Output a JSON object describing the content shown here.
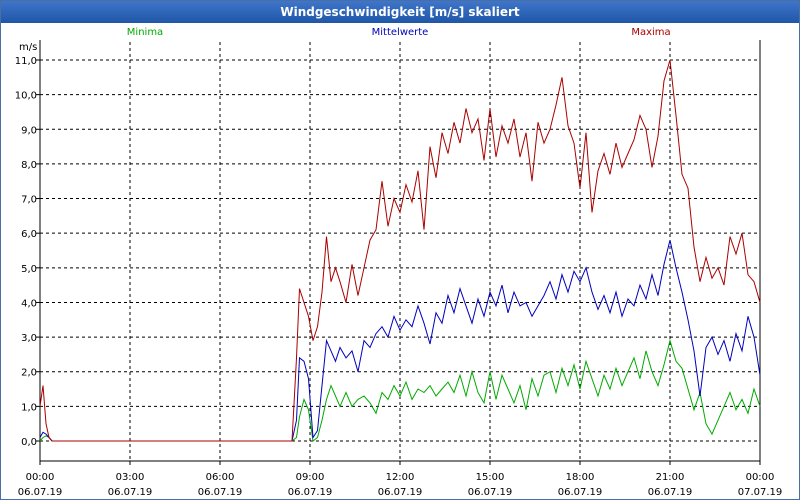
{
  "window": {
    "title": "Windgeschwindigkeit [m/s] skaliert"
  },
  "colors": {
    "min": "#00aa00",
    "mean": "#0000bb",
    "max": "#aa0000",
    "grid": "#000000"
  },
  "chart_data": {
    "type": "line",
    "title": "Windgeschwindigkeit [m/s] skaliert",
    "ylabel": "m/s",
    "ylim": [
      0,
      11
    ],
    "xlim": [
      "06.07.19 00:00",
      "07.07.19 00:00"
    ],
    "grid": true,
    "legend_position": "top",
    "yticks": [
      "0,0",
      "1,0",
      "2,0",
      "3,0",
      "4,0",
      "5,0",
      "6,0",
      "7,0",
      "8,0",
      "9,0",
      "10,0",
      "11,0"
    ],
    "xticks": [
      {
        "time": "00:00",
        "date": "06.07.19"
      },
      {
        "time": "03:00",
        "date": "06.07.19"
      },
      {
        "time": "06:00",
        "date": "06.07.19"
      },
      {
        "time": "09:00",
        "date": "06.07.19"
      },
      {
        "time": "12:00",
        "date": "06.07.19"
      },
      {
        "time": "15:00",
        "date": "06.07.19"
      },
      {
        "time": "18:00",
        "date": "06.07.19"
      },
      {
        "time": "21:00",
        "date": "06.07.19"
      },
      {
        "time": "00:00",
        "date": "07.07.19"
      }
    ],
    "series": [
      {
        "name": "Minima",
        "color": "#00aa00",
        "points": [
          [
            0,
            0.0
          ],
          [
            0.1,
            0.1
          ],
          [
            0.2,
            0.15
          ],
          [
            0.3,
            0.1
          ],
          [
            0.4,
            0.0
          ],
          [
            8.4,
            0.0
          ],
          [
            8.55,
            0.1
          ],
          [
            8.65,
            0.7
          ],
          [
            8.8,
            1.2
          ],
          [
            8.95,
            0.9
          ],
          [
            9.1,
            0.0
          ],
          [
            9.25,
            0.1
          ],
          [
            9.4,
            0.6
          ],
          [
            9.55,
            1.2
          ],
          [
            9.7,
            1.6
          ],
          [
            9.85,
            1.3
          ],
          [
            10.0,
            1.0
          ],
          [
            10.2,
            1.4
          ],
          [
            10.4,
            1.0
          ],
          [
            10.6,
            1.2
          ],
          [
            10.8,
            1.3
          ],
          [
            11.0,
            1.1
          ],
          [
            11.2,
            0.8
          ],
          [
            11.4,
            1.4
          ],
          [
            11.6,
            1.2
          ],
          [
            11.8,
            1.6
          ],
          [
            12.0,
            1.3
          ],
          [
            12.2,
            1.7
          ],
          [
            12.4,
            1.2
          ],
          [
            12.6,
            1.5
          ],
          [
            12.8,
            1.4
          ],
          [
            13.0,
            1.6
          ],
          [
            13.2,
            1.3
          ],
          [
            13.4,
            1.5
          ],
          [
            13.6,
            1.7
          ],
          [
            13.8,
            1.4
          ],
          [
            14.0,
            1.9
          ],
          [
            14.2,
            1.3
          ],
          [
            14.4,
            2.0
          ],
          [
            14.6,
            1.4
          ],
          [
            14.8,
            1.1
          ],
          [
            15.0,
            2.0
          ],
          [
            15.2,
            1.2
          ],
          [
            15.4,
            1.9
          ],
          [
            15.6,
            1.5
          ],
          [
            15.8,
            1.1
          ],
          [
            16.0,
            1.6
          ],
          [
            16.2,
            0.9
          ],
          [
            16.4,
            1.8
          ],
          [
            16.6,
            1.3
          ],
          [
            16.8,
            1.9
          ],
          [
            17.0,
            2.0
          ],
          [
            17.2,
            1.4
          ],
          [
            17.4,
            2.1
          ],
          [
            17.6,
            1.6
          ],
          [
            17.8,
            2.2
          ],
          [
            18.0,
            1.5
          ],
          [
            18.2,
            2.3
          ],
          [
            18.4,
            1.8
          ],
          [
            18.6,
            1.3
          ],
          [
            18.8,
            1.9
          ],
          [
            19.0,
            1.5
          ],
          [
            19.2,
            2.1
          ],
          [
            19.4,
            1.6
          ],
          [
            19.6,
            2.0
          ],
          [
            19.8,
            2.4
          ],
          [
            20.0,
            1.8
          ],
          [
            20.2,
            2.6
          ],
          [
            20.4,
            2.0
          ],
          [
            20.6,
            1.6
          ],
          [
            20.8,
            2.2
          ],
          [
            21.0,
            2.9
          ],
          [
            21.2,
            2.3
          ],
          [
            21.4,
            2.1
          ],
          [
            21.6,
            1.5
          ],
          [
            21.8,
            0.9
          ],
          [
            22.0,
            1.4
          ],
          [
            22.2,
            0.5
          ],
          [
            22.4,
            0.2
          ],
          [
            22.6,
            0.6
          ],
          [
            22.8,
            1.0
          ],
          [
            23.0,
            1.4
          ],
          [
            23.2,
            0.9
          ],
          [
            23.4,
            1.2
          ],
          [
            23.6,
            0.8
          ],
          [
            23.8,
            1.5
          ],
          [
            24.0,
            1.0
          ]
        ]
      },
      {
        "name": "Mittelwerte",
        "color": "#0000bb",
        "points": [
          [
            0,
            0.1
          ],
          [
            0.1,
            0.25
          ],
          [
            0.2,
            0.2
          ],
          [
            0.3,
            0.1
          ],
          [
            0.4,
            0.0
          ],
          [
            8.4,
            0.0
          ],
          [
            8.55,
            0.6
          ],
          [
            8.65,
            2.4
          ],
          [
            8.8,
            2.3
          ],
          [
            8.95,
            1.8
          ],
          [
            9.1,
            0.1
          ],
          [
            9.25,
            0.3
          ],
          [
            9.4,
            1.6
          ],
          [
            9.55,
            2.9
          ],
          [
            9.7,
            2.6
          ],
          [
            9.85,
            2.3
          ],
          [
            10.0,
            2.7
          ],
          [
            10.2,
            2.4
          ],
          [
            10.4,
            2.6
          ],
          [
            10.6,
            2.0
          ],
          [
            10.8,
            2.9
          ],
          [
            11.0,
            2.7
          ],
          [
            11.2,
            3.1
          ],
          [
            11.4,
            3.3
          ],
          [
            11.6,
            3.0
          ],
          [
            11.8,
            3.6
          ],
          [
            12.0,
            3.2
          ],
          [
            12.2,
            3.5
          ],
          [
            12.4,
            3.3
          ],
          [
            12.6,
            3.9
          ],
          [
            12.8,
            3.4
          ],
          [
            13.0,
            2.8
          ],
          [
            13.2,
            3.7
          ],
          [
            13.4,
            3.4
          ],
          [
            13.6,
            4.2
          ],
          [
            13.8,
            3.7
          ],
          [
            14.0,
            4.4
          ],
          [
            14.2,
            3.9
          ],
          [
            14.4,
            3.4
          ],
          [
            14.6,
            4.1
          ],
          [
            14.8,
            3.6
          ],
          [
            15.0,
            4.3
          ],
          [
            15.2,
            3.9
          ],
          [
            15.4,
            4.5
          ],
          [
            15.6,
            3.7
          ],
          [
            15.8,
            4.3
          ],
          [
            16.0,
            3.9
          ],
          [
            16.2,
            4.0
          ],
          [
            16.4,
            3.6
          ],
          [
            16.6,
            3.9
          ],
          [
            16.8,
            4.2
          ],
          [
            17.0,
            4.6
          ],
          [
            17.2,
            4.1
          ],
          [
            17.4,
            4.8
          ],
          [
            17.6,
            4.3
          ],
          [
            17.8,
            4.9
          ],
          [
            18.0,
            4.6
          ],
          [
            18.2,
            5.0
          ],
          [
            18.4,
            4.3
          ],
          [
            18.6,
            3.8
          ],
          [
            18.8,
            4.2
          ],
          [
            19.0,
            3.7
          ],
          [
            19.2,
            4.3
          ],
          [
            19.4,
            3.6
          ],
          [
            19.6,
            4.1
          ],
          [
            19.8,
            3.9
          ],
          [
            20.0,
            4.5
          ],
          [
            20.2,
            4.1
          ],
          [
            20.4,
            4.8
          ],
          [
            20.6,
            4.2
          ],
          [
            20.8,
            5.1
          ],
          [
            21.0,
            5.8
          ],
          [
            21.2,
            5.0
          ],
          [
            21.4,
            4.3
          ],
          [
            21.6,
            3.5
          ],
          [
            21.8,
            2.6
          ],
          [
            22.0,
            1.3
          ],
          [
            22.2,
            2.7
          ],
          [
            22.4,
            3.0
          ],
          [
            22.6,
            2.5
          ],
          [
            22.8,
            2.9
          ],
          [
            23.0,
            2.3
          ],
          [
            23.2,
            3.1
          ],
          [
            23.4,
            2.6
          ],
          [
            23.6,
            3.6
          ],
          [
            23.8,
            3.0
          ],
          [
            24.0,
            1.9
          ]
        ]
      },
      {
        "name": "Maxima",
        "color": "#aa0000",
        "points": [
          [
            0,
            1.0
          ],
          [
            0.1,
            1.6
          ],
          [
            0.2,
            0.5
          ],
          [
            0.3,
            0.1
          ],
          [
            0.4,
            0.0
          ],
          [
            8.4,
            0.0
          ],
          [
            8.55,
            2.4
          ],
          [
            8.65,
            4.4
          ],
          [
            8.8,
            4.0
          ],
          [
            8.95,
            3.6
          ],
          [
            9.1,
            2.9
          ],
          [
            9.25,
            3.3
          ],
          [
            9.4,
            4.3
          ],
          [
            9.55,
            5.9
          ],
          [
            9.7,
            4.6
          ],
          [
            9.85,
            5.0
          ],
          [
            10.0,
            4.6
          ],
          [
            10.2,
            4.0
          ],
          [
            10.4,
            5.1
          ],
          [
            10.6,
            4.2
          ],
          [
            10.8,
            5.0
          ],
          [
            11.0,
            5.8
          ],
          [
            11.2,
            6.1
          ],
          [
            11.4,
            7.5
          ],
          [
            11.6,
            6.2
          ],
          [
            11.8,
            7.0
          ],
          [
            12.0,
            6.6
          ],
          [
            12.2,
            7.4
          ],
          [
            12.4,
            6.9
          ],
          [
            12.6,
            7.8
          ],
          [
            12.8,
            6.1
          ],
          [
            13.0,
            8.5
          ],
          [
            13.2,
            7.6
          ],
          [
            13.4,
            8.9
          ],
          [
            13.6,
            8.3
          ],
          [
            13.8,
            9.2
          ],
          [
            14.0,
            8.6
          ],
          [
            14.2,
            9.6
          ],
          [
            14.4,
            8.9
          ],
          [
            14.6,
            9.3
          ],
          [
            14.8,
            8.1
          ],
          [
            15.0,
            9.6
          ],
          [
            15.2,
            8.2
          ],
          [
            15.4,
            9.1
          ],
          [
            15.6,
            8.6
          ],
          [
            15.8,
            9.3
          ],
          [
            16.0,
            8.2
          ],
          [
            16.2,
            8.9
          ],
          [
            16.4,
            7.5
          ],
          [
            16.6,
            9.2
          ],
          [
            16.8,
            8.6
          ],
          [
            17.0,
            9.0
          ],
          [
            17.2,
            9.7
          ],
          [
            17.4,
            10.5
          ],
          [
            17.6,
            9.1
          ],
          [
            17.8,
            8.6
          ],
          [
            18.0,
            7.3
          ],
          [
            18.2,
            8.9
          ],
          [
            18.4,
            6.6
          ],
          [
            18.6,
            7.8
          ],
          [
            18.8,
            8.3
          ],
          [
            19.0,
            7.7
          ],
          [
            19.2,
            8.6
          ],
          [
            19.4,
            7.9
          ],
          [
            19.6,
            8.3
          ],
          [
            19.8,
            8.7
          ],
          [
            20.0,
            9.4
          ],
          [
            20.2,
            9.0
          ],
          [
            20.4,
            7.9
          ],
          [
            20.6,
            8.8
          ],
          [
            20.8,
            10.4
          ],
          [
            21.0,
            11.0
          ],
          [
            21.2,
            9.4
          ],
          [
            21.4,
            7.7
          ],
          [
            21.6,
            7.3
          ],
          [
            21.8,
            5.6
          ],
          [
            22.0,
            4.6
          ],
          [
            22.2,
            5.3
          ],
          [
            22.4,
            4.7
          ],
          [
            22.6,
            5.0
          ],
          [
            22.8,
            4.5
          ],
          [
            23.0,
            5.9
          ],
          [
            23.2,
            5.4
          ],
          [
            23.4,
            6.0
          ],
          [
            23.6,
            4.8
          ],
          [
            23.8,
            4.6
          ],
          [
            24.0,
            4.0
          ]
        ]
      }
    ]
  }
}
